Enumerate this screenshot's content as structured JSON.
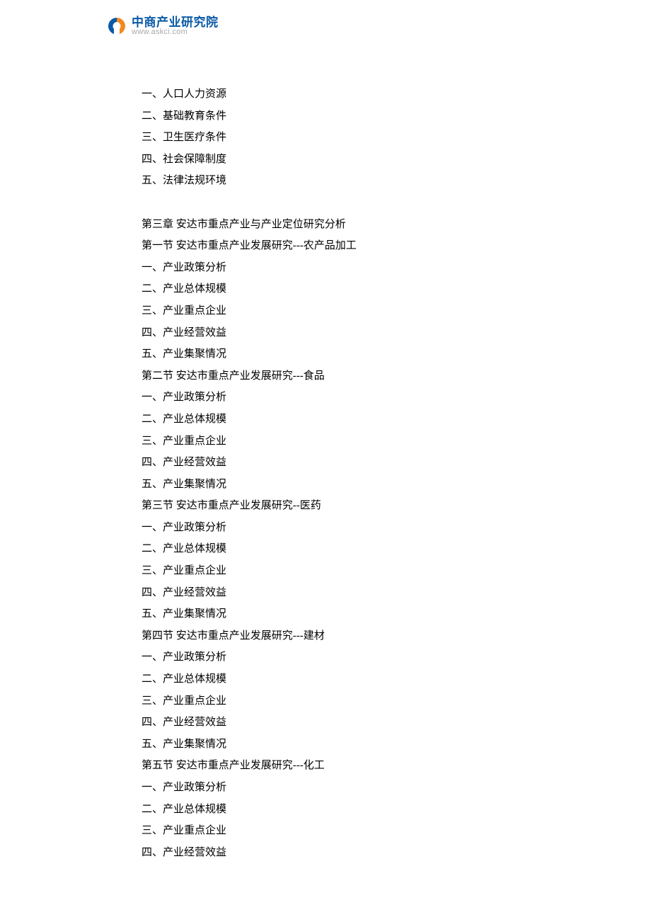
{
  "logo": {
    "cn": "中商产业研究院",
    "url": "www.askci.com"
  },
  "lines": [
    "一、人口人力资源",
    "二、基础教育条件",
    "三、卫生医疗条件",
    "四、社会保障制度",
    "五、法律法规环境",
    "",
    "第三章 安达市重点产业与产业定位研究分析",
    "第一节 安达市重点产业发展研究---农产品加工",
    "一、产业政策分析",
    "二、产业总体规模",
    "三、产业重点企业",
    "四、产业经营效益",
    "五、产业集聚情况",
    "第二节 安达市重点产业发展研究---食品",
    "一、产业政策分析",
    "二、产业总体规模",
    "三、产业重点企业",
    "四、产业经营效益",
    "五、产业集聚情况",
    "第三节 安达市重点产业发展研究--医药",
    "一、产业政策分析",
    "二、产业总体规模",
    "三、产业重点企业",
    "四、产业经营效益",
    "五、产业集聚情况",
    "第四节 安达市重点产业发展研究---建材",
    "一、产业政策分析",
    "二、产业总体规模",
    "三、产业重点企业",
    "四、产业经营效益",
    "五、产业集聚情况",
    "第五节 安达市重点产业发展研究---化工",
    "一、产业政策分析",
    "二、产业总体规模",
    "三、产业重点企业",
    "四、产业经营效益"
  ]
}
